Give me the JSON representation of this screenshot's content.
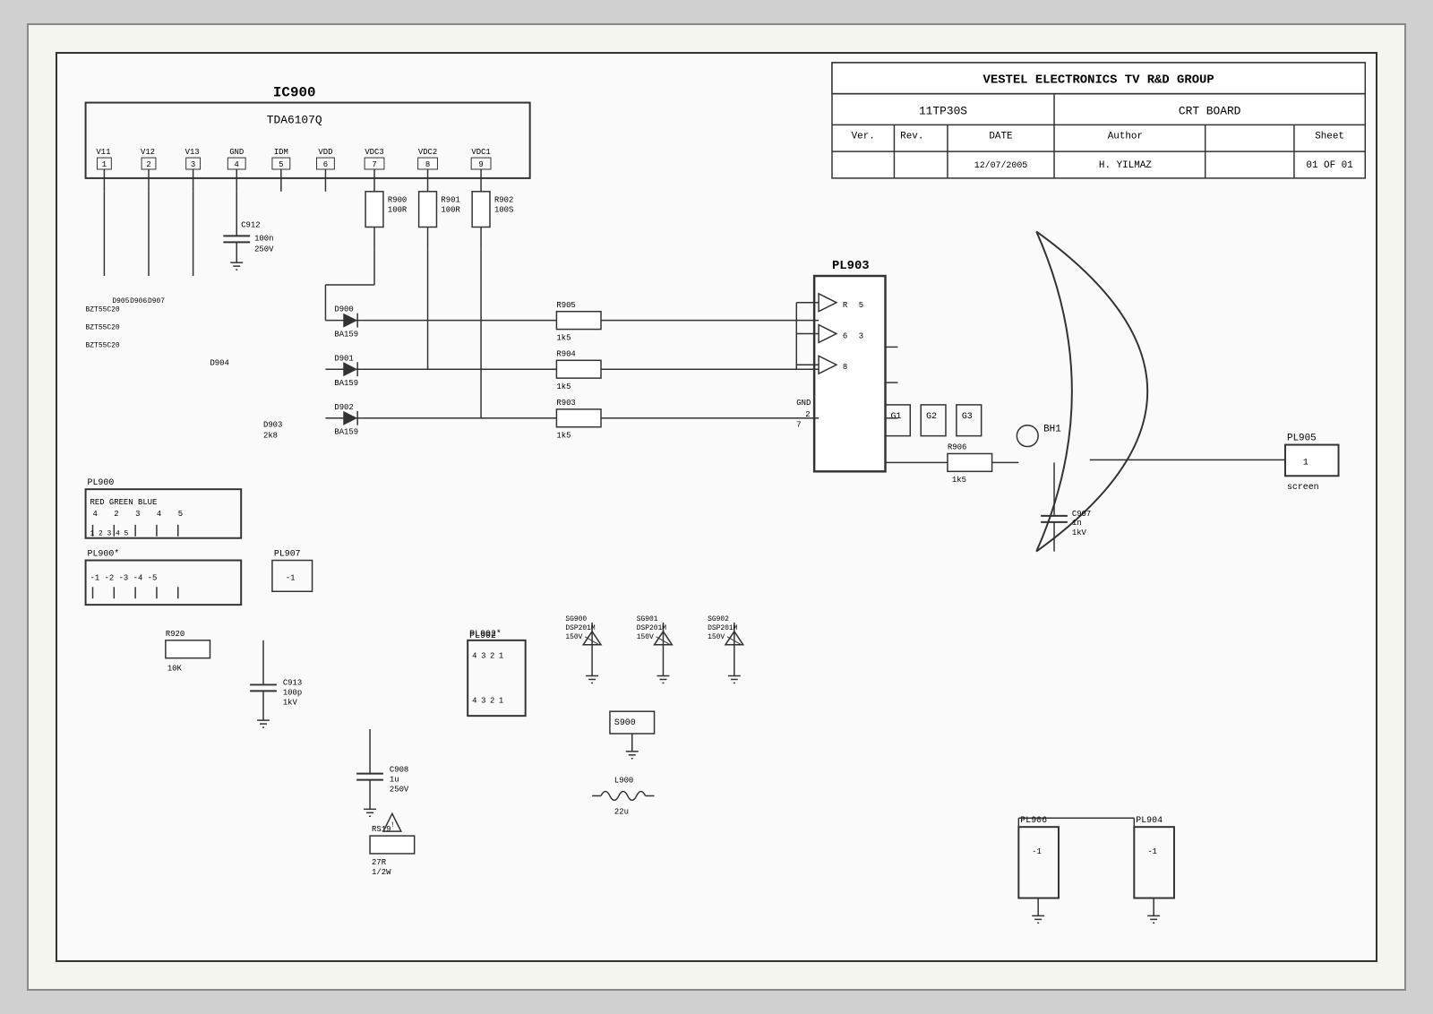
{
  "title_block": {
    "company": "VESTEL ELECTRONICS TV R&D GROUP",
    "product": "11TP30S",
    "board": "CRT BOARD",
    "ver_label": "Ver.",
    "rev_label": "Rev.",
    "date_label": "DATE",
    "author_label": "Author",
    "sheet_label": "Sheet",
    "date_value": "12/07/2005",
    "author_value": "H. YILMAZ",
    "sheet_value": "01 OF 01"
  },
  "ic900": {
    "label": "IC900",
    "sublabel": "TDA6107Q",
    "pins": [
      {
        "num": "1",
        "name": "V11"
      },
      {
        "num": "2",
        "name": "V12"
      },
      {
        "num": "3",
        "name": "V13"
      },
      {
        "num": "4",
        "name": "GND"
      },
      {
        "num": "5",
        "name": "IDM"
      },
      {
        "num": "6",
        "name": "VDD"
      },
      {
        "num": "7",
        "name": "VDC3"
      },
      {
        "num": "8",
        "name": "VDC2"
      },
      {
        "num": "9",
        "name": "VDC1"
      }
    ]
  },
  "components": {
    "C912": "C912\n100n\n250V",
    "C913": "C913\n100p\n1kV",
    "C908": "C908\n1u\n250V",
    "C907": "C907\n1n\n1kV",
    "R920": "R920\n10K",
    "R903": "R903\n1k5",
    "R904": "R904\n1k5",
    "R905": "R905\n1k5",
    "R906": "R906\n1k5",
    "R900": "R900\n100R",
    "R901": "R901\n100R",
    "R902": "R902\n100S",
    "RS19": "RS19\n27R\n1/2W",
    "D900": "D900\nBA159",
    "D901": "D901\nBA159",
    "D902": "D902\nBA159",
    "D903": "D903\n2k8",
    "D904": "D904",
    "D905": "D905",
    "D906": "D906",
    "D907": "D907",
    "L900": "L900\n22u",
    "S900": "S900",
    "SG900": "SG900\nDSP201M\n150V",
    "SG901": "SG901\nDSP201M\n150V",
    "SG902": "SG902\nDSP201M\n150V",
    "PL900": "PL900",
    "PL900s": "PL900*",
    "PL902": "PL902",
    "PL902s": "PL902*",
    "PL903": "PL903",
    "PL904": "PL904",
    "PL905": "PL905",
    "PL906": "PL906",
    "PL907": "PL907",
    "BH1": "BH1",
    "BZT55C20_1": "BZT55C20",
    "BZT55C20_2": "BZT55C20",
    "BZT55C20_3": "BZT55C20"
  }
}
